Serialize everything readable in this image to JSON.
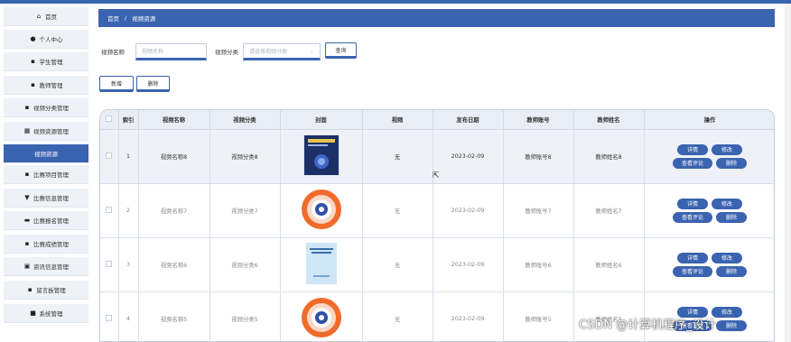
{
  "sidebar": {
    "items": [
      {
        "label": "首页",
        "icon": "home-icon",
        "glyph": "⌂"
      },
      {
        "label": "个人中心",
        "icon": "user-icon",
        "glyph": "●"
      },
      {
        "label": "学生管理",
        "icon": "grid-icon",
        "glyph": "▪"
      },
      {
        "label": "教师管理",
        "icon": "grid-icon",
        "glyph": "▪"
      },
      {
        "label": "视频分类管理",
        "icon": "grid-icon",
        "glyph": "▪"
      },
      {
        "label": "视频资源管理",
        "icon": "table-icon",
        "glyph": "▦"
      },
      {
        "label": "视频资源",
        "icon": "",
        "glyph": ""
      },
      {
        "label": "比赛项目管理",
        "icon": "grid-icon",
        "glyph": "▪"
      },
      {
        "label": "比赛信息管理",
        "icon": "trophy-icon",
        "glyph": "▼"
      },
      {
        "label": "比赛报名管理",
        "icon": "briefcase-icon",
        "glyph": "▬"
      },
      {
        "label": "比赛成绩管理",
        "icon": "grid-icon",
        "glyph": "▪"
      },
      {
        "label": "资讯信息管理",
        "icon": "document-icon",
        "glyph": "▣"
      },
      {
        "label": "留言板管理",
        "icon": "grid-icon",
        "glyph": "▪"
      },
      {
        "label": "系统管理",
        "icon": "folder-icon",
        "glyph": "■"
      }
    ],
    "active_index": 6
  },
  "breadcrumb": {
    "home": "首页",
    "separator": "/",
    "current": "视频资源"
  },
  "search": {
    "name_label": "视频名称",
    "name_placeholder": "视频名称",
    "category_label": "视频分类",
    "category_placeholder": "请选择视频分类",
    "query_button": "查询"
  },
  "actions": {
    "add_button": "新增",
    "delete_button": "删除"
  },
  "table": {
    "columns": [
      "",
      "索引",
      "视频名称",
      "视频分类",
      "封面",
      "视频",
      "发布日期",
      "教师账号",
      "教师姓名",
      "操作"
    ],
    "rows": [
      {
        "index": "1",
        "name": "视频名称8",
        "category": "视频分类8",
        "video": "无",
        "date": "2023-02-09",
        "account": "教师账号8",
        "teacher": "教师姓名8",
        "cover": "book-dark"
      },
      {
        "index": "2",
        "name": "视频名称7",
        "category": "视频分类7",
        "video": "无",
        "date": "2023-02-09",
        "account": "教师账号7",
        "teacher": "教师姓名7",
        "cover": "ring"
      },
      {
        "index": "3",
        "name": "视频名称6",
        "category": "视频分类6",
        "video": "无",
        "date": "2023-02-09",
        "account": "教师账号6",
        "teacher": "教师姓名6",
        "cover": "book-light"
      },
      {
        "index": "4",
        "name": "视频名称5",
        "category": "视频分类5",
        "video": "无",
        "date": "2023-02-09",
        "account": "教师账号5",
        "teacher": "教师姓名5",
        "cover": "ring"
      }
    ],
    "ops": {
      "detail": "详情",
      "edit": "修改",
      "comments": "查看评论",
      "delete": "删除"
    }
  },
  "watermark": "CSDN @计算机程序_设计",
  "colors": {
    "primary": "#3a63b0",
    "sidebar_bg": "#eef1f7",
    "header_bg": "#e9edf5"
  }
}
